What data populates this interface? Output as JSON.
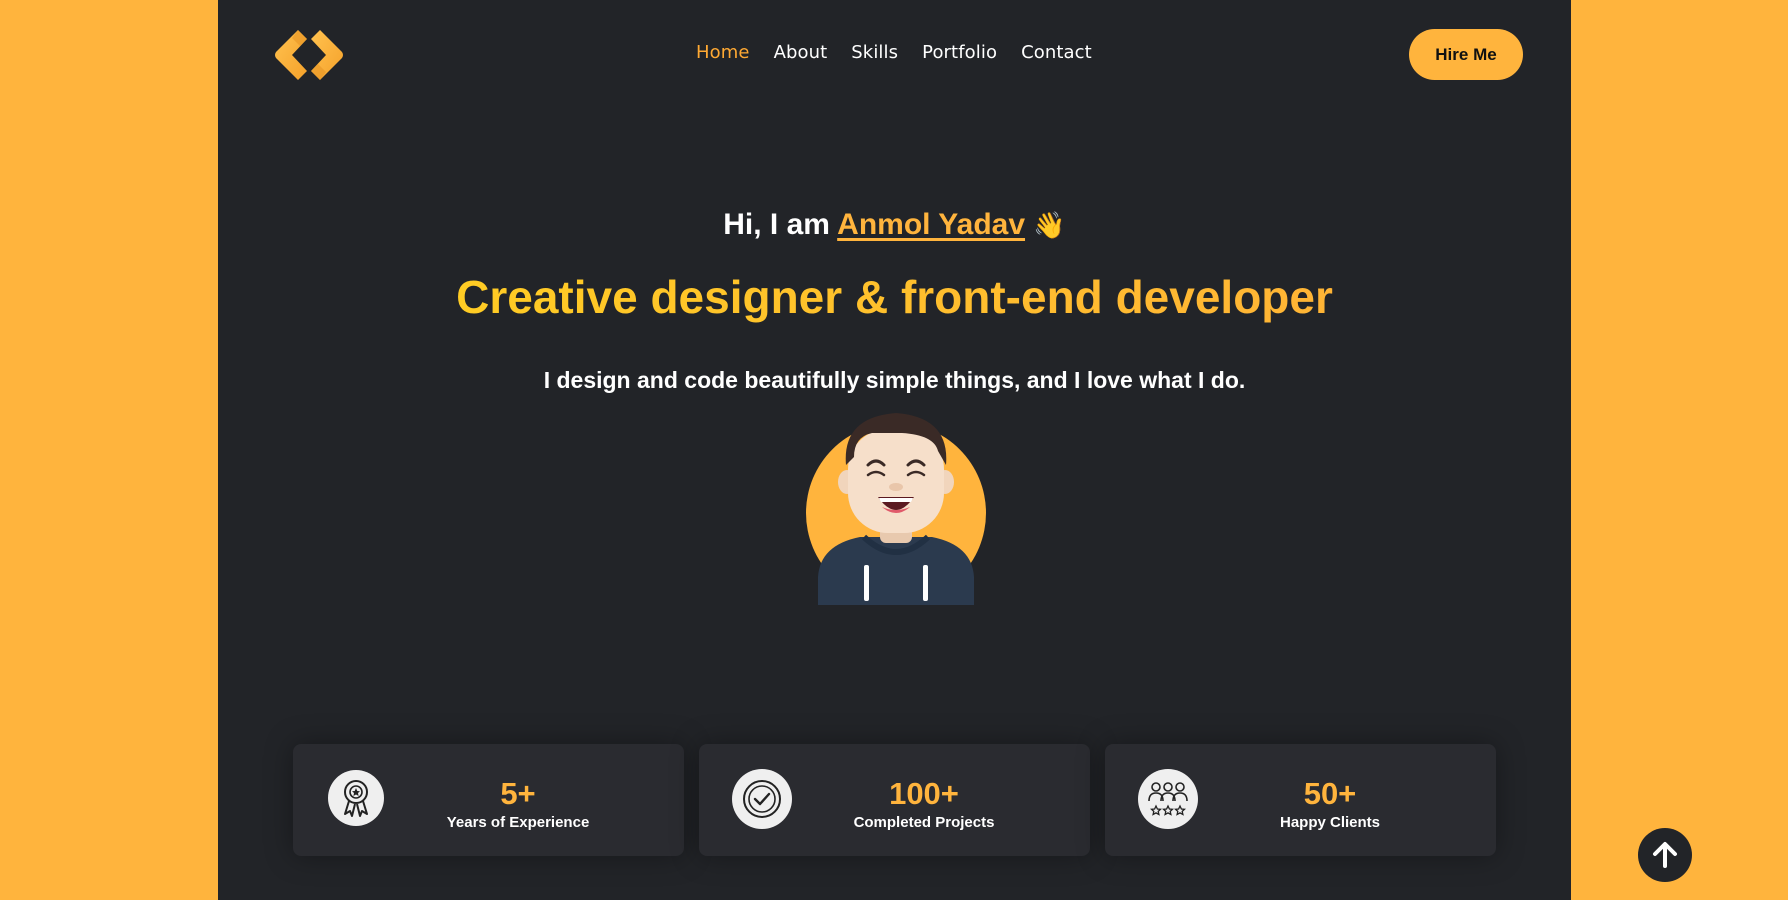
{
  "header": {
    "logo_icon": "code-brackets-logo",
    "nav": [
      {
        "label": "Home",
        "active": true
      },
      {
        "label": "About",
        "active": false
      },
      {
        "label": "Skills",
        "active": false
      },
      {
        "label": "Portfolio",
        "active": false
      },
      {
        "label": "Contact",
        "active": false
      }
    ],
    "hire_label": "Hire Me"
  },
  "hero": {
    "greeting_prefix": "Hi, I am",
    "name": "Anmol Yadav",
    "wave": "👋",
    "headline": "Creative designer & front-end developer",
    "tagline": "I design and code beautifully simple things, and I love what I do.",
    "avatar_icon": "smiling-person-avatar"
  },
  "stats": [
    {
      "value": "5+",
      "label": "Years of Experience",
      "icon": "award-medal-icon"
    },
    {
      "value": "100+",
      "label": "Completed Projects",
      "icon": "check-circle-icon"
    },
    {
      "value": "50+",
      "label": "Happy Clients",
      "icon": "clients-rating-icon"
    }
  ],
  "scroll_top_icon": "arrow-up-icon",
  "colors": {
    "accent": "#FFB43D",
    "background": "#222428",
    "outer": "#FFB43D",
    "card": "#2A2B30"
  }
}
